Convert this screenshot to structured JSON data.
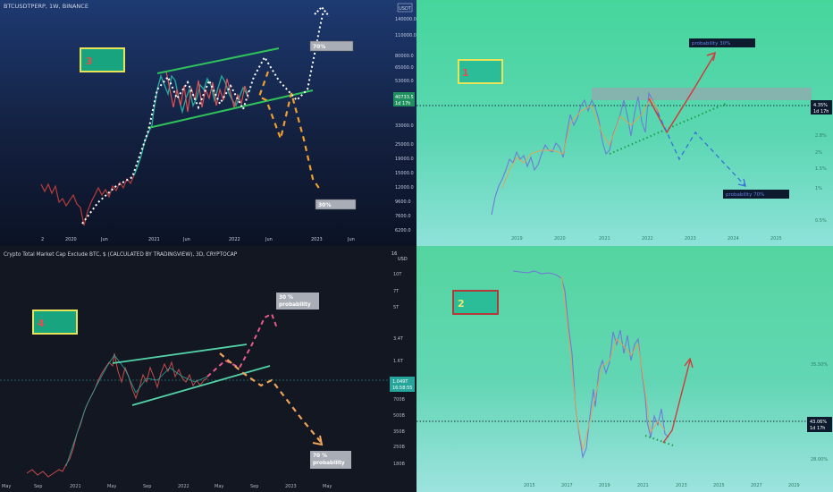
{
  "charts": {
    "p1": {
      "header": "BTCUSDTPERP, 1W, BINANCE",
      "currency_badge": "USDT",
      "price_axis": [
        "140000.0",
        "110000.0",
        "80000.0",
        "65000.0",
        "53000.0",
        "40733.5",
        "33000.0",
        "25000.0",
        "19000.0",
        "15000.0",
        "12000.0",
        "9600.0",
        "7600.0",
        "6200.0"
      ],
      "last_price": "40733.5",
      "last_time": "1d 17h",
      "time_axis": [
        "2",
        "2020",
        "Jun",
        "2021",
        "Jun",
        "2022",
        "Jun",
        "2023",
        "Jun"
      ],
      "marker_number": "3",
      "label_top": "70%",
      "label_bottom": "30%"
    },
    "p2": {
      "price_axis": [
        "4.35%",
        "2.8%",
        "2%",
        "1.5%",
        "1%",
        "0.5%"
      ],
      "last_price": "4.35%",
      "last_time": "1d 17h",
      "time_axis": [
        "2019",
        "2020",
        "2021",
        "2022",
        "2023",
        "2024",
        "2025"
      ],
      "marker_number": "1",
      "probability_up": "probability 30%",
      "probability_down": "probability 70%"
    },
    "p3": {
      "header": "Crypto Total Market Cap Exclude BTC, $ (CALCULATED BY TRADINGVIEW), 3D, CRYPTOCAP",
      "corner_label": "16",
      "currency_badge": "USD",
      "price_axis": [
        "10T",
        "7T",
        "5T",
        "3.4T",
        "1.6T",
        "700B",
        "500B",
        "350B",
        "250B",
        "180B"
      ],
      "last_price": "1.049T",
      "last_time": "16:58:55",
      "time_axis": [
        "May",
        "Sep",
        "2021",
        "May",
        "Sep",
        "2022",
        "May",
        "Sep",
        "2023",
        "May"
      ],
      "marker_number": "4",
      "label_top_line1": "30 %",
      "label_top_line2": "probability",
      "label_bottom_line1": "70 %",
      "label_bottom_line2": "probability"
    },
    "p4": {
      "price_axis": [
        "43.06%",
        "35.50%",
        "28.00%"
      ],
      "last_price": "43.06%",
      "last_time": "1d 17h",
      "time_axis": [
        "2015",
        "2017",
        "2019",
        "2021",
        "2023",
        "2025",
        "2027",
        "2029"
      ],
      "marker_number": "2"
    }
  }
}
